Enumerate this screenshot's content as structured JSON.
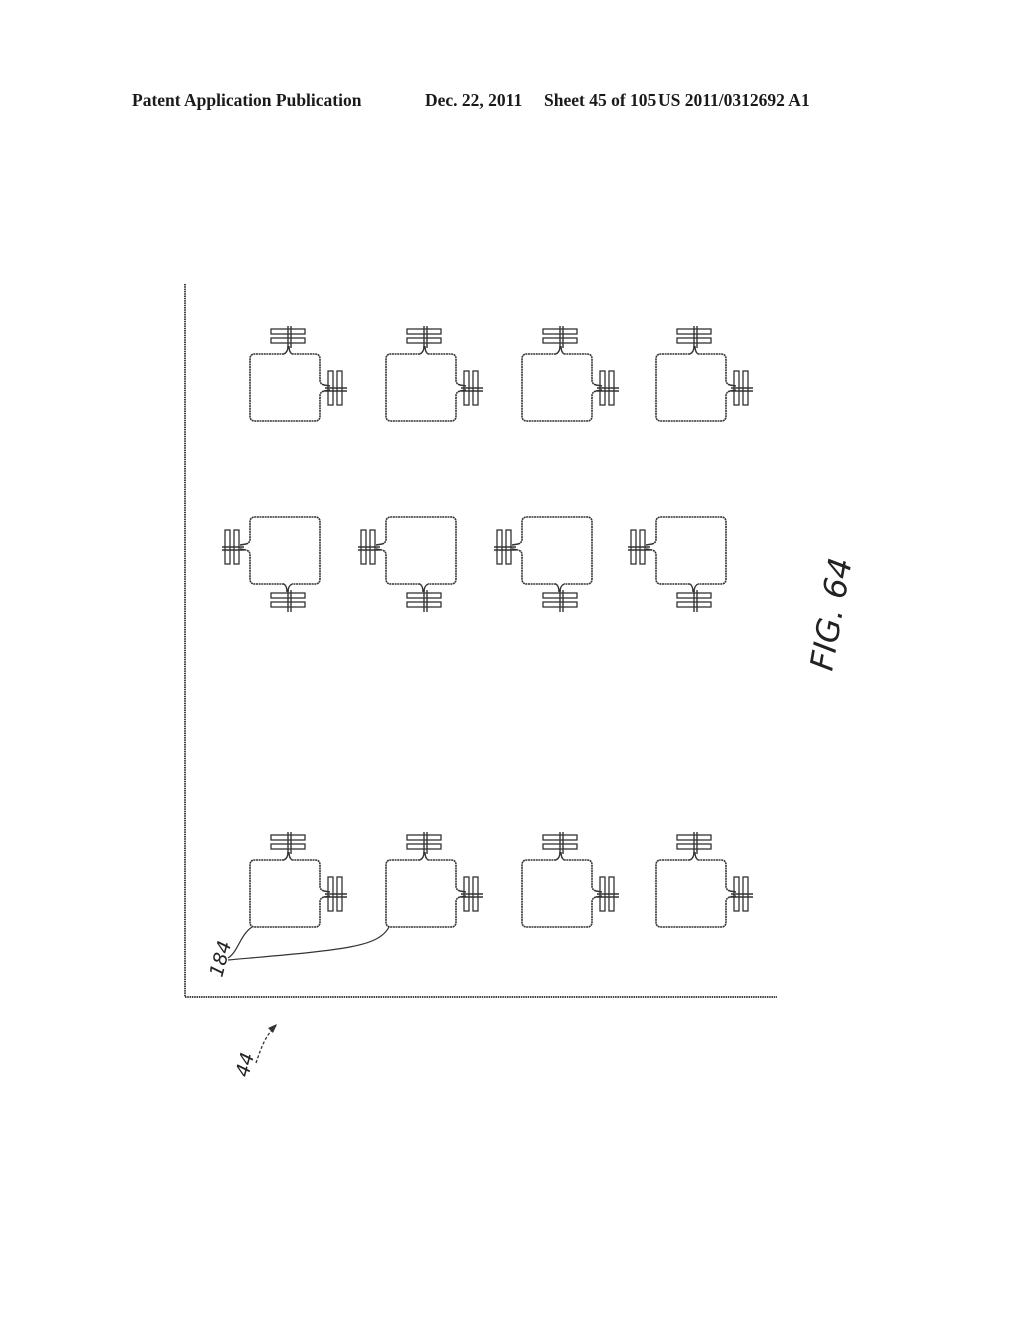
{
  "header": {
    "publication": "Patent Application Publication",
    "date": "Dec. 22, 2011",
    "sheet": "Sheet 45 of 105",
    "document_number": "US 2011/0312692 A1"
  },
  "figure": {
    "label": "FIG. 64",
    "sheet_reference": "44",
    "element_reference": "184",
    "element_description": "loop antenna with two capacitor/terminal connectors",
    "grid": {
      "rows": 3,
      "columns": 4,
      "row_orientations": [
        "top-right",
        "left-bottom",
        "top-right"
      ]
    }
  },
  "colors": {
    "line": "#333333",
    "background": "#ffffff"
  }
}
